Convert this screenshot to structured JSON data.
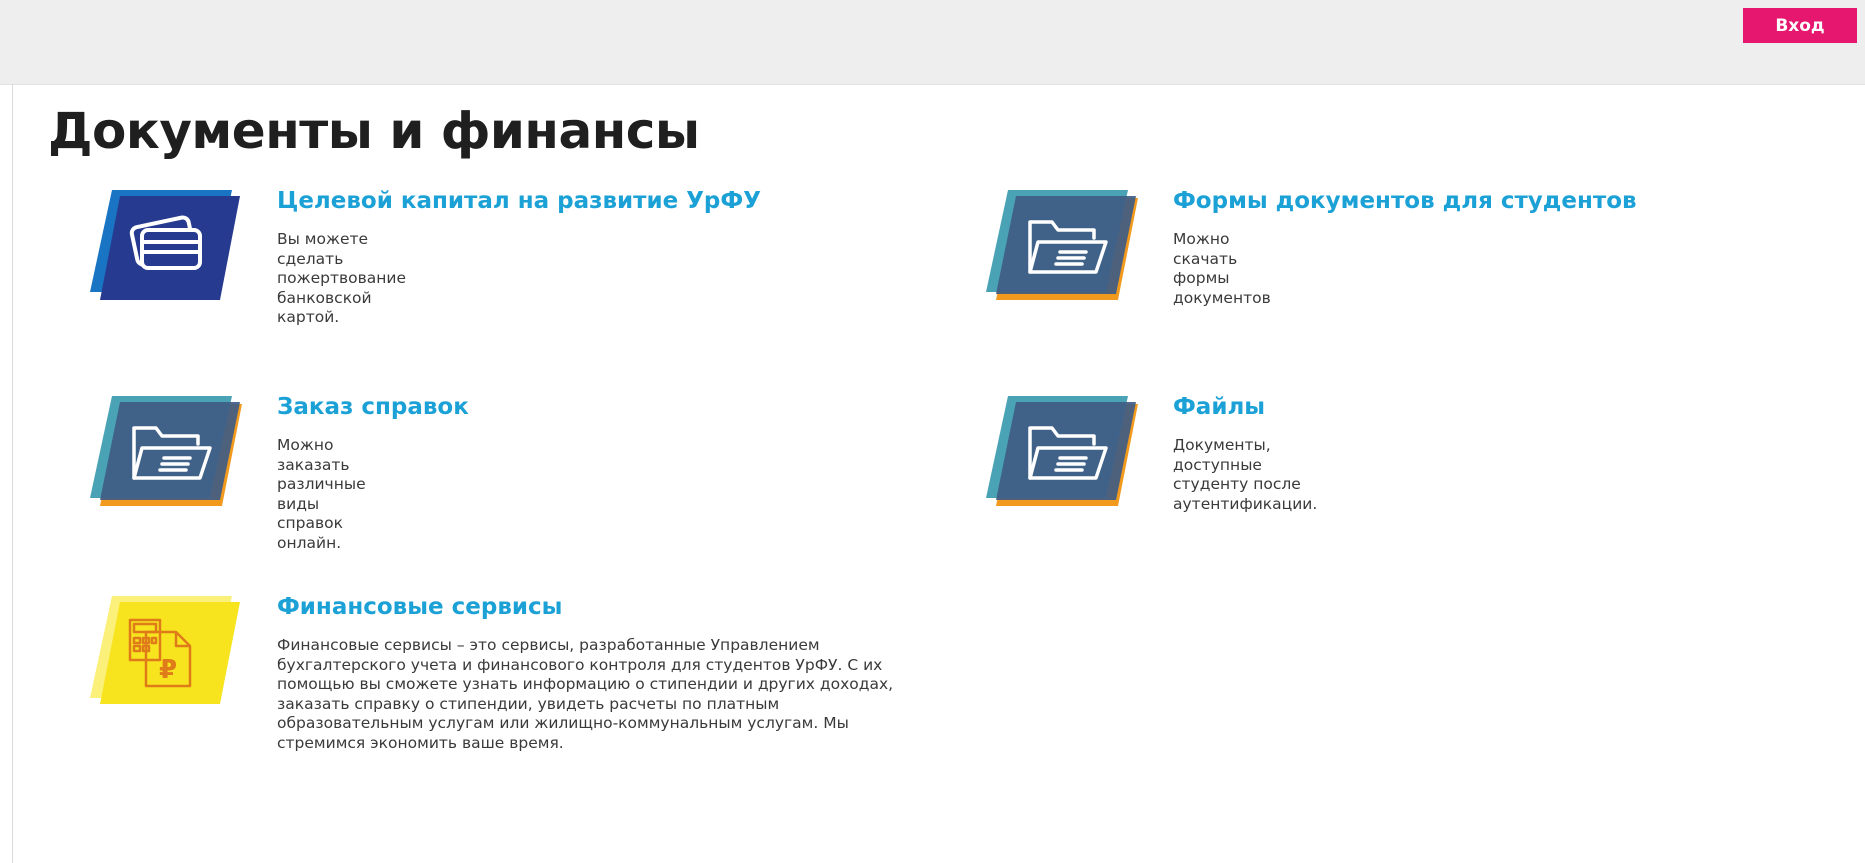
{
  "header": {
    "login_label": "Вход"
  },
  "page": {
    "title": "Документы и финансы"
  },
  "cards": [
    {
      "title": "Целевой капитал на развитие УрФУ",
      "description": "Вы можете сделать пожертвование банковской картой.",
      "icon": "credit-card-icon"
    },
    {
      "title": "Формы документов для студентов",
      "description": "Можно скачать формы документов",
      "icon": "folder-icon"
    },
    {
      "title": "Заказ справок",
      "description": "Можно заказать различные виды справок онлайн.",
      "icon": "folder-icon"
    },
    {
      "title": "Файлы",
      "description": "Документы, доступные студенту после аутентификации.",
      "icon": "folder-icon"
    },
    {
      "title": "Финансовые сервисы",
      "description": "Финансовые сервисы – это сервисы, разработанные Управлением бухгалтерского учета и финансового контроля для студентов УрФУ. С их помощью вы сможете узнать информацию о стипендии и других доходах, заказать справку о стипендии, увидеть расчеты по платным образовательным услугам или жилищно-коммунальным услугам. Мы стремимся экономить ваше время.",
      "icon": "ruble-calculator-icon"
    }
  ],
  "colors": {
    "accent_pink": "#e5176e",
    "link_blue": "#1ba1d6",
    "card_blue_dark": "#233a8c",
    "card_blue_light": "#1a74c4",
    "folder_teal": "#4aa3b5",
    "folder_slate": "#3f5c85",
    "folder_orange": "#f29a1d",
    "finance_yellow": "#f7e41f"
  }
}
